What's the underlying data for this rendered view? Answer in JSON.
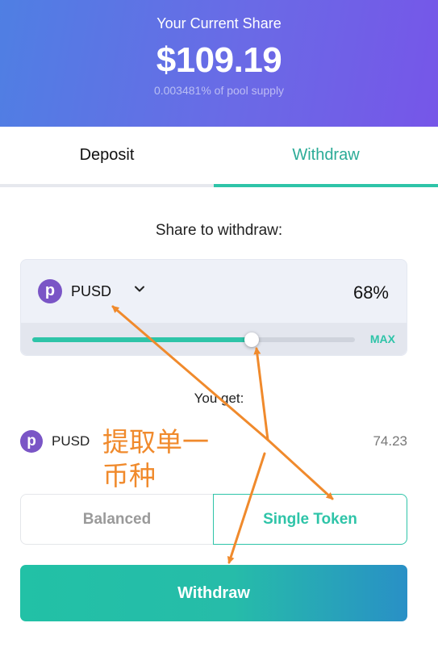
{
  "hero": {
    "label": "Your Current Share",
    "value": "$109.19",
    "subtitle": "0.003481% of pool supply"
  },
  "tabs": [
    {
      "label": "Deposit",
      "active": false
    },
    {
      "label": "Withdraw",
      "active": true
    }
  ],
  "withdraw": {
    "share_label": "Share to withdraw:",
    "token": {
      "symbol": "PUSD",
      "logo_letter": "p",
      "logo_color": "#7a55c6"
    },
    "percent_text": "68%",
    "slider_fraction": 0.68,
    "max_label": "MAX",
    "you_get_label": "You get:",
    "output": {
      "symbol": "PUSD",
      "logo_letter": "p",
      "amount": "74.23"
    },
    "modes": [
      {
        "label": "Balanced",
        "selected": false
      },
      {
        "label": "Single Token",
        "selected": true
      }
    ],
    "submit_label": "Withdraw"
  },
  "annotation": {
    "line1": "提取单一",
    "line2": "币种",
    "color": "#f08a2c"
  },
  "colors": {
    "accent": "#2ec4a8",
    "hero_start": "#4f7fe3",
    "hero_end": "#7656e8",
    "button_end": "#2990c6"
  }
}
